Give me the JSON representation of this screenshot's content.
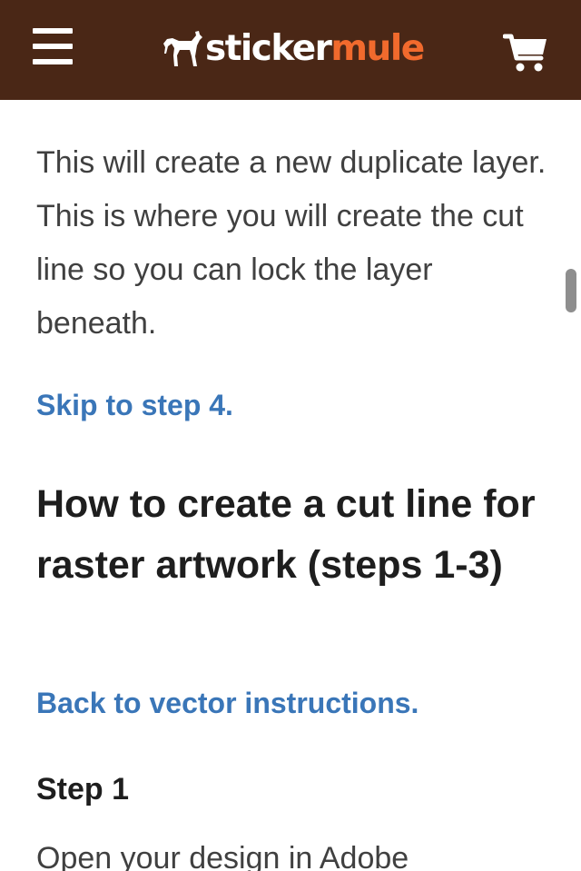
{
  "header": {
    "brand_part1": "sticker",
    "brand_part2": "mule",
    "menu_icon": "hamburger-menu-icon",
    "logo_icon": "mule-silhouette-icon",
    "cart_icon": "shopping-cart-icon",
    "colors": {
      "background": "#4a2716",
      "brand_accent": "#f16a2d",
      "icon": "#ffffff"
    }
  },
  "article": {
    "paragraph": "This will create a new duplicate layer. This is where you will create the cut line so you can lock the layer beneath.",
    "skip_link": "Skip to step 4.",
    "heading": "How to create a cut line for raster artwork (steps 1-3)",
    "back_link": "Back to vector instructions.",
    "step_title": "Step 1",
    "step_text": "Open your design in Adobe",
    "colors": {
      "link": "#3a76b8",
      "heading": "#1e1e1e",
      "body": "#404040"
    }
  }
}
